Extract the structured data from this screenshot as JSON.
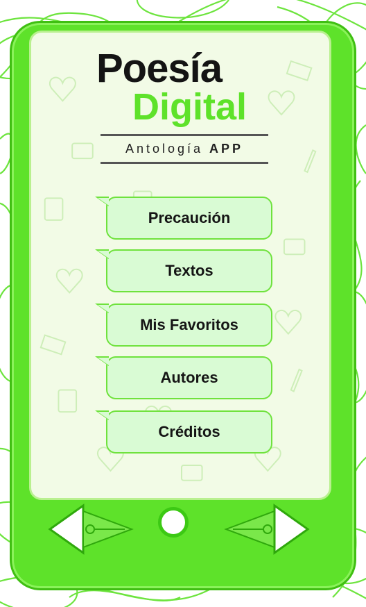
{
  "app": {
    "title_line1": "Poesía",
    "title_line2": "Digital",
    "subtitle_light": "Antología",
    "subtitle_bold": "APP"
  },
  "menu": {
    "items": [
      {
        "label": "Precaución"
      },
      {
        "label": "Textos"
      },
      {
        "label": "Mis Favoritos"
      },
      {
        "label": "Autores"
      },
      {
        "label": "Créditos"
      }
    ]
  },
  "nav": {
    "prev_icon": "triangle-left-icon",
    "home_icon": "circle-home-icon",
    "next_icon": "triangle-right-icon"
  },
  "colors": {
    "accent": "#5ee22a",
    "screen": "#f2fbe6",
    "button_fill": "#d9fbd4",
    "button_border": "#6fe23d",
    "title_dark": "#141414"
  }
}
